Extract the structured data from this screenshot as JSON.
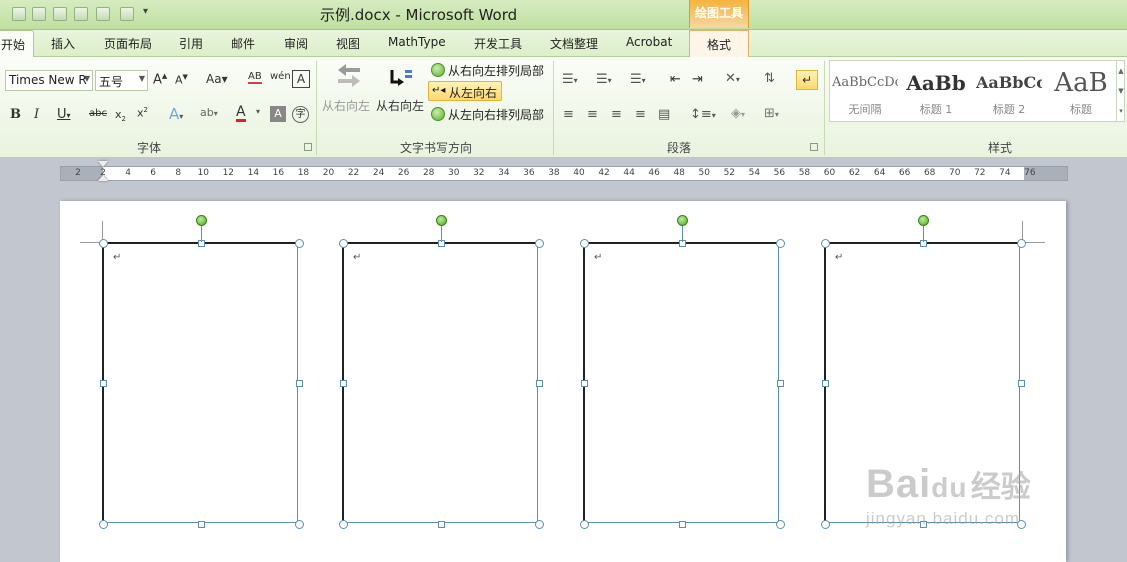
{
  "window": {
    "title": "示例.docx - Microsoft Word",
    "contextual_tab_group": "绘图工具"
  },
  "tabs": [
    {
      "label": "开始",
      "active": true
    },
    {
      "label": "插入"
    },
    {
      "label": "页面布局"
    },
    {
      "label": "引用"
    },
    {
      "label": "邮件"
    },
    {
      "label": "审阅"
    },
    {
      "label": "视图"
    },
    {
      "label": "MathType"
    },
    {
      "label": "开发工具"
    },
    {
      "label": "文档整理"
    },
    {
      "label": "Acrobat"
    },
    {
      "label": "格式",
      "contextual": true
    }
  ],
  "ribbon": {
    "font": {
      "group_label": "字体",
      "font_name": "Times New R",
      "font_size": "五号"
    },
    "text_direction": {
      "group_label": "文字书写方向",
      "rtl_button_dim": "从右向左",
      "rtl_button": "从右向左",
      "options": [
        {
          "label": "从右向左排列局部",
          "selected": false
        },
        {
          "label": "从左向右",
          "selected": true
        },
        {
          "label": "从左向右排列局部",
          "selected": false
        }
      ]
    },
    "paragraph": {
      "group_label": "段落"
    },
    "styles": {
      "group_label": "样式",
      "items": [
        {
          "sample": "AaBbCcDc",
          "name": "无间隔"
        },
        {
          "sample": "AaBb",
          "name": "标题 1"
        },
        {
          "sample": "AaBbCc",
          "name": "标题 2"
        },
        {
          "sample": "AaB",
          "name": "标题"
        }
      ]
    }
  },
  "ruler": {
    "ticks": [
      "2",
      "2",
      "4",
      "6",
      "8",
      "10",
      "12",
      "14",
      "16",
      "18",
      "20",
      "22",
      "24",
      "26",
      "28",
      "30",
      "32",
      "34",
      "36",
      "38",
      "40",
      "42",
      "44",
      "46",
      "48",
      "50",
      "52",
      "54",
      "56",
      "58",
      "60",
      "62",
      "64",
      "66",
      "68",
      "70",
      "72",
      "74",
      "76"
    ]
  },
  "document": {
    "paragraph_mark": "↵",
    "frame_count": 4
  },
  "watermark": {
    "brand": "Bai",
    "brand_paw": "du",
    "brand_cn": "经验",
    "url": "jingyan.baidu.com"
  }
}
